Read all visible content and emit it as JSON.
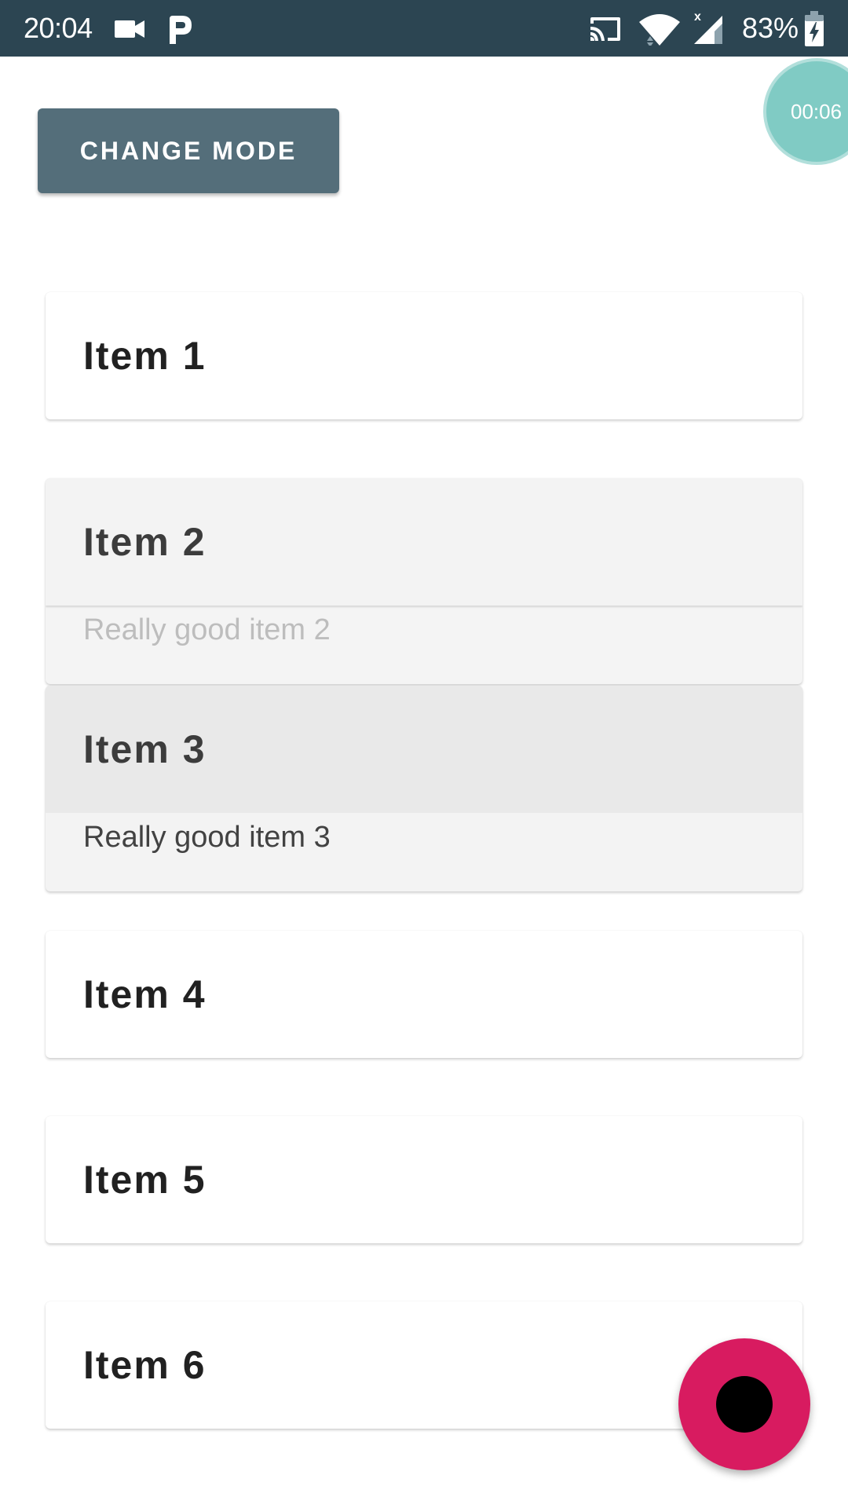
{
  "status_bar": {
    "time": "20:04",
    "battery_percent": "83%",
    "icons": [
      "video-camera-icon",
      "p-app-icon",
      "cast-icon",
      "wifi-icon",
      "cellular-signal-icon",
      "battery-charging-icon"
    ],
    "background_color": "#2c4552"
  },
  "header": {
    "change_mode_label": "CHANGE MODE",
    "button_color": "#546e7a"
  },
  "recording_timer": {
    "time": "00:06",
    "color": "#80cbc4"
  },
  "items": [
    {
      "title": "Item 1",
      "state": "collapsed"
    },
    {
      "title": "Item 2",
      "subtitle": "Really good item 2",
      "state": "expanded"
    },
    {
      "title": "Item 3",
      "subtitle": "Really good item 3",
      "state": "expanded-pressed"
    },
    {
      "title": "Item 4",
      "state": "collapsed"
    },
    {
      "title": "Item 5",
      "state": "collapsed"
    },
    {
      "title": "Item 6",
      "state": "collapsed"
    }
  ],
  "fab": {
    "icon": "circle-icon",
    "color": "#d81b60"
  }
}
